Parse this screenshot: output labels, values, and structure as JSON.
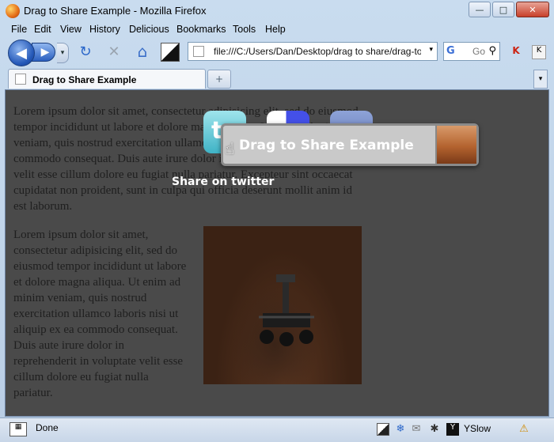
{
  "window": {
    "title": "Drag to Share Example - Mozilla Firefox",
    "min": "—",
    "max": "□",
    "close": "✕"
  },
  "menu": [
    "File",
    "Edit",
    "View",
    "History",
    "Delicious",
    "Bookmarks",
    "Tools",
    "Help"
  ],
  "nav": {
    "url": "file:///C:/Users/Dan/Desktop/drag to share/drag-to-share.html",
    "search_placeholder": "Go",
    "back": "◀",
    "forward": "▶",
    "drop": "▾",
    "reload": "↻",
    "stop": "✕",
    "home": "⌂"
  },
  "tab": {
    "label": "Drag to Share Example",
    "new": "+",
    "list": "▾"
  },
  "content": {
    "para1": "Lorem ipsum dolor sit amet, consectetur adipisicing elit, sed do eiusmod tempor incididunt ut labore et dolore magna aliqua. Ut enim ad minim veniam, quis nostrud exercitation ullamco laboris nisi ut aliquip ex ea commodo consequat. Duis aute irure dolor in reprehenderit in voluptate velit esse cillum dolore eu fugiat nulla pariatur. Excepteur sint occaecat cupidatat non proident, sunt in culpa qui officia deserunt mollit anim id est laborum.",
    "para2": "Lorem ipsum dolor sit amet, consectetur adipisicing elit, sed do eiusmod tempor incididunt ut labore et dolore magna aliqua. Ut enim ad minim veniam, quis nostrud exercitation ullamco laboris nisi ut aliquip ex ea commodo consequat. Duis aute irure dolor in reprehenderit in voluptate velit esse cillum dolore eu fugiat nulla pariatur."
  },
  "share": {
    "drag_label": "Drag to Share Example",
    "target_label": "Share on twitter"
  },
  "status": {
    "text": "Done",
    "yslow": "YSlow"
  }
}
